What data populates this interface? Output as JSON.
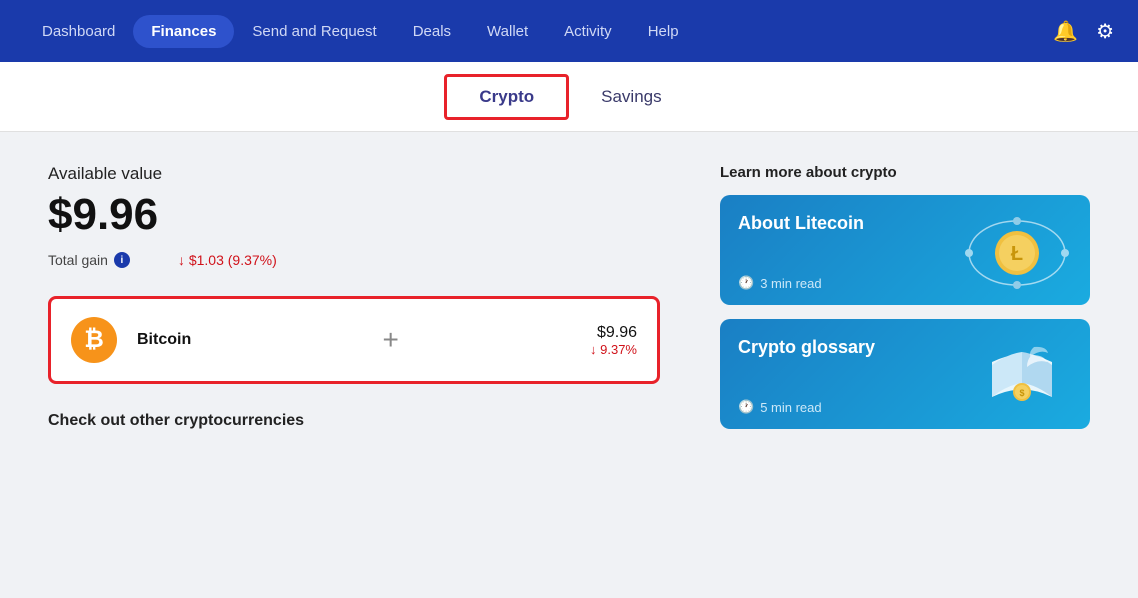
{
  "navbar": {
    "items": [
      {
        "label": "Dashboard",
        "active": false
      },
      {
        "label": "Finances",
        "active": true
      },
      {
        "label": "Send and Request",
        "active": false
      },
      {
        "label": "Deals",
        "active": false
      },
      {
        "label": "Wallet",
        "active": false
      },
      {
        "label": "Activity",
        "active": false
      },
      {
        "label": "Help",
        "active": false
      }
    ],
    "bell_icon": "🔔",
    "gear_icon": "⚙"
  },
  "tabs": {
    "items": [
      {
        "label": "Crypto",
        "selected": true
      },
      {
        "label": "Savings",
        "selected": false
      }
    ]
  },
  "main": {
    "available_label": "Available value",
    "available_value": "$9.96",
    "total_gain_label": "Total gain",
    "total_gain_value": "↓ $1.03 (9.37%)",
    "bitcoin": {
      "symbol": "₿",
      "label": "Bitcoin",
      "plus": "+",
      "usd": "$9.96",
      "pct": "↓ 9.37%"
    },
    "check_other": "Check out other cryptocurrencies"
  },
  "right": {
    "learn_label": "Learn more about crypto",
    "cards": [
      {
        "title": "About Litecoin",
        "read_time": "3 min read"
      },
      {
        "title": "Crypto glossary",
        "read_time": "5 min read"
      }
    ]
  }
}
